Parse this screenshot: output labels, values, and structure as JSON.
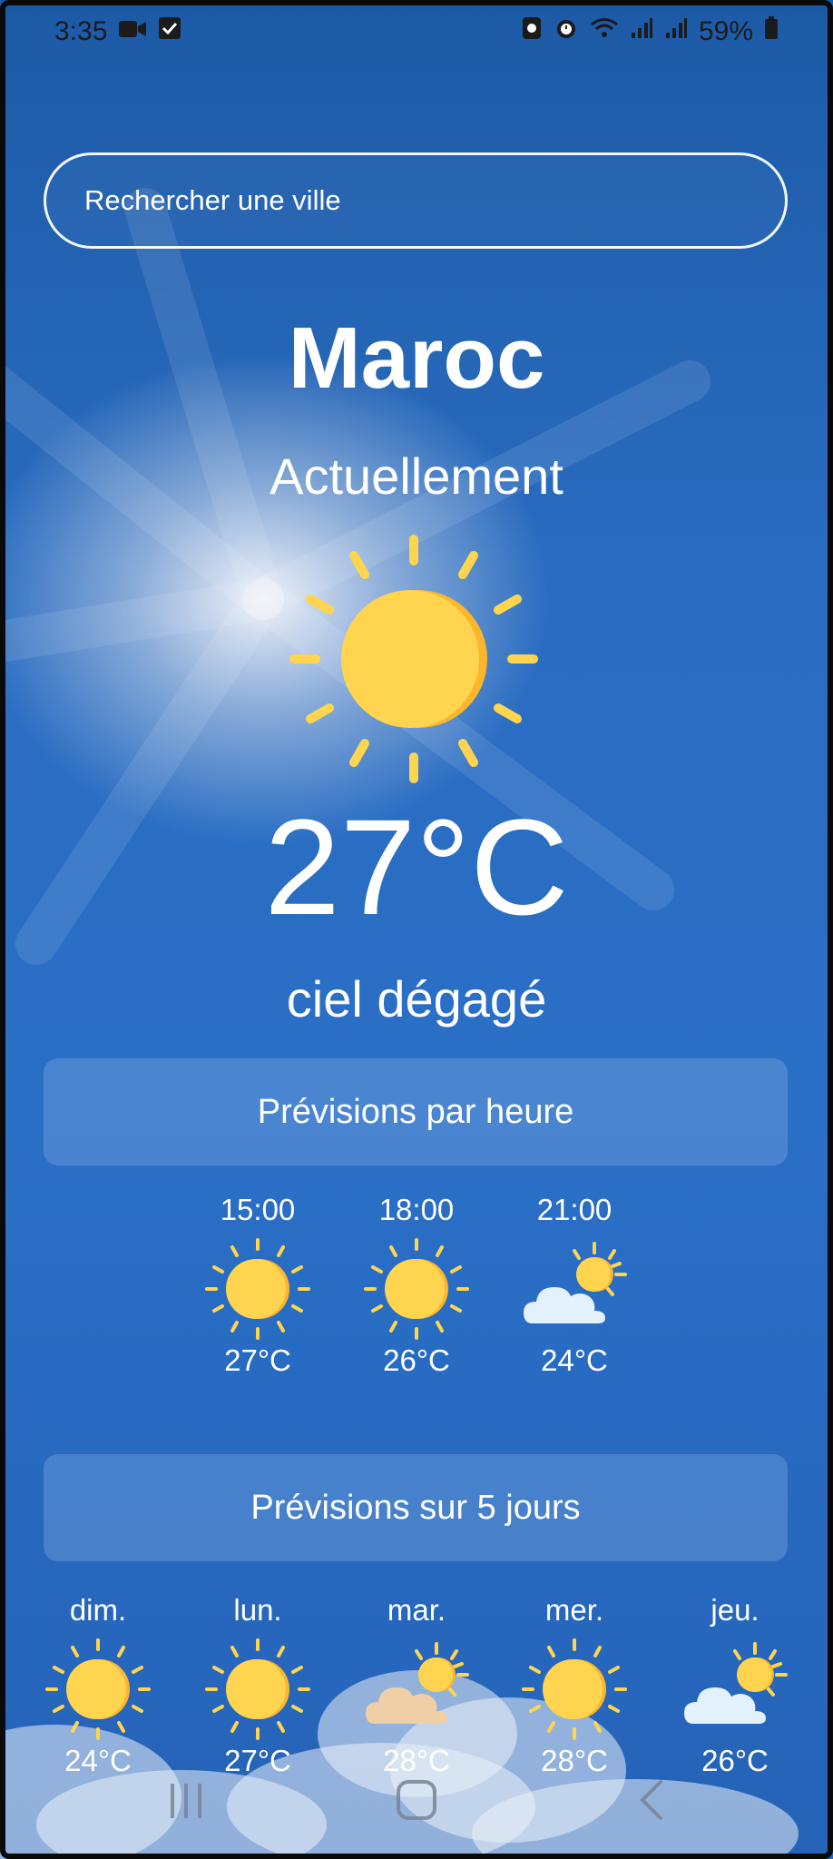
{
  "status_bar": {
    "time": "3:35",
    "battery": "59%",
    "icons_left": [
      "video-camera-icon",
      "checkbox-icon"
    ],
    "icons_right": [
      "nfc-icon",
      "alarm-icon",
      "wifi-icon",
      "signal-icon",
      "signal-icon",
      "battery-icon"
    ]
  },
  "search": {
    "placeholder": "Rechercher une ville"
  },
  "location": {
    "city": "Maroc"
  },
  "current": {
    "label": "Actuellement",
    "temperature": "27°C",
    "description": "ciel dégagé",
    "icon": "sun-icon"
  },
  "hourly": {
    "title": "Prévisions par heure",
    "items": [
      {
        "time": "15:00",
        "temp": "27°C",
        "icon": "sun-icon"
      },
      {
        "time": "18:00",
        "temp": "26°C",
        "icon": "sun-icon"
      },
      {
        "time": "21:00",
        "temp": "24°C",
        "icon": "partly-cloudy-icon"
      }
    ]
  },
  "daily": {
    "title": "Prévisions sur 5 jours",
    "items": [
      {
        "day": "dim.",
        "temp": "24°C",
        "icon": "sun-icon"
      },
      {
        "day": "lun.",
        "temp": "27°C",
        "icon": "sun-icon"
      },
      {
        "day": "mar.",
        "temp": "28°C",
        "icon": "partly-cloudy-icon"
      },
      {
        "day": "mer.",
        "temp": "28°C",
        "icon": "sun-icon"
      },
      {
        "day": "jeu.",
        "temp": "26°C",
        "icon": "partly-cloudy-icon"
      }
    ]
  },
  "nav_bar": {
    "buttons": [
      "recents-icon",
      "home-icon",
      "back-icon"
    ]
  },
  "colors": {
    "sky_top": "#1d5aa6",
    "sky_mid": "#2a6fc7",
    "sun": "#ffd54f",
    "sun_shade": "#fbb62d",
    "cloud": "#e3f1fc"
  }
}
